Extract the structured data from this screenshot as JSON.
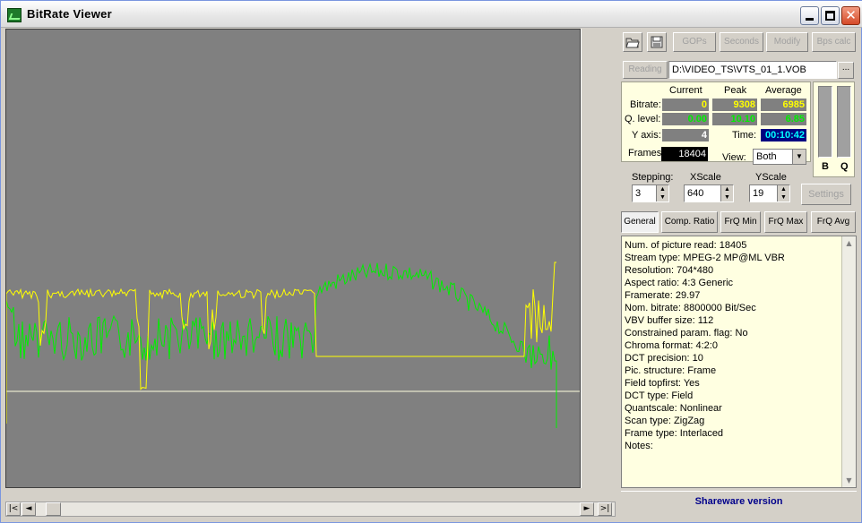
{
  "window": {
    "title": "BitRate  Viewer"
  },
  "toolbar": {
    "open_icon": "folder-open-icon",
    "save_icon": "floppy-disk-icon",
    "gops_label": "GOPs",
    "seconds_label": "Seconds",
    "modify_label": "Modify",
    "bps_calc_label": "Bps calc"
  },
  "file": {
    "reading_label": "Reading",
    "path": "D:\\VIDEO_TS\\VTS_01_1.VOB",
    "browse_label": "..."
  },
  "stats": {
    "col_current": "Current",
    "col_peak": "Peak",
    "col_average": "Average",
    "bitrate_label": "Bitrate:",
    "bitrate_current": "0",
    "bitrate_peak": "9308",
    "bitrate_average": "6985",
    "qlevel_label": "Q. level:",
    "qlevel_current": "0.00",
    "qlevel_peak": "10.10",
    "qlevel_average": "6.85",
    "yaxis_label": "Y axis:",
    "yaxis_value": "4",
    "time_label": "Time:",
    "time_value": "00:10:42",
    "frames_label": "Frames:",
    "frames_value": "18404",
    "view_label": "View:",
    "view_value": "Both"
  },
  "meters": {
    "b_label": "B",
    "q_label": "Q"
  },
  "controls": {
    "stepping_label": "Stepping:",
    "stepping_value": "3",
    "xscale_label": "XScale",
    "xscale_value": "640",
    "yscale_label": "YScale",
    "yscale_value": "19",
    "settings_label": "Settings"
  },
  "tabs": [
    {
      "label": "General"
    },
    {
      "label": "Comp. Ratio"
    },
    {
      "label": "FrQ Min"
    },
    {
      "label": "FrQ Max"
    },
    {
      "label": "FrQ Avg"
    }
  ],
  "info_lines": [
    "Num. of picture read: 18405",
    "Stream type: MPEG-2  MP@ML  VBR",
    "Resolution: 704*480",
    "Aspect ratio: 4:3 Generic",
    "Framerate: 29.97",
    "Nom. bitrate: 8800000 Bit/Sec",
    "VBV buffer size: 112",
    "Constrained param. flag: No",
    "Chroma format: 4:2:0",
    "DCT precision: 10",
    "Pic. structure: Frame",
    "Field topfirst: Yes",
    "DCT type: Field",
    "Quantscale: Nonlinear",
    "Scan type: ZigZag",
    "Frame type: Interlaced",
    "Notes:"
  ],
  "footer": {
    "shareware": "Shareware version"
  },
  "colors": {
    "bitrate_series": "#ffff00",
    "qlevel_series": "#00ee00",
    "plot_background": "#808080"
  }
}
